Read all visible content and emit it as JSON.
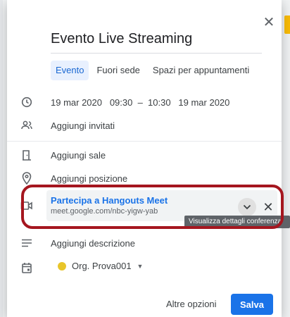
{
  "dialog": {
    "close_symbol": "✕",
    "title": "Evento Live Streaming",
    "tabs": [
      {
        "label": "Evento"
      },
      {
        "label": "Fuori sede"
      },
      {
        "label": "Spazi per appuntamenti"
      }
    ],
    "datetime": "19 mar 2020   09:30  –  10:30   19 mar 2020",
    "add_guests": "Aggiungi invitati",
    "add_rooms": "Aggiungi sale",
    "add_location": "Aggiungi posizione",
    "meet": {
      "title": "Partecipa a Hangouts Meet",
      "url": "meet.google.com/nbc-yigw-yab",
      "remove_symbol": "✕",
      "tooltip": "Visualizza dettagli conferenza"
    },
    "add_description": "Aggiungi descrizione",
    "calendar": {
      "name": "Org. Prova001",
      "caret": "▼",
      "color": "#e8c52a"
    },
    "more_options": "Altre opzioni",
    "save": "Salva"
  },
  "colors": {
    "accent": "#1a73e8",
    "highlight_border": "#a5161f",
    "tab_active_bg": "#e8f0fe"
  },
  "icons": [
    "clock-icon",
    "people-icon",
    "door-icon",
    "location-pin-icon",
    "video-camera-icon",
    "description-icon",
    "calendar-icon",
    "chevron-down-icon",
    "close-icon"
  ]
}
